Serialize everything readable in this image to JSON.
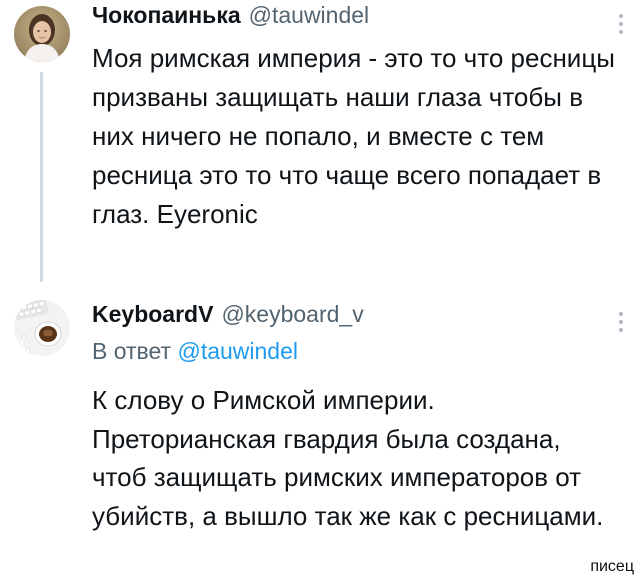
{
  "tweets": [
    {
      "display_name": "Чокопаинька",
      "handle": "@tauwindel",
      "avatar_icon": "user-photo-icon",
      "text": "Моя римская империя - это то что ресницы призваны защищать наши глаза чтобы в них ничего не попало, и вместе с тем ресница это то что чаще всего попадает в глаз. Eyeronic"
    },
    {
      "display_name": "KeyboardV",
      "handle": "@keyboard_v",
      "avatar_icon": "coffee-keyboard-icon",
      "reply_prefix": "В ответ",
      "reply_to": "@tauwindel",
      "text": "К слову о Римской империи. Преторианская гвардия была создана, чтоб защищать римских императоров от убийств, а вышло так же как с ресницами."
    }
  ],
  "watermark": "писец",
  "colors": {
    "text": "#0f1419",
    "secondary": "#536471",
    "accent": "#1d9bf0",
    "thread_line": "#cfd9de"
  }
}
